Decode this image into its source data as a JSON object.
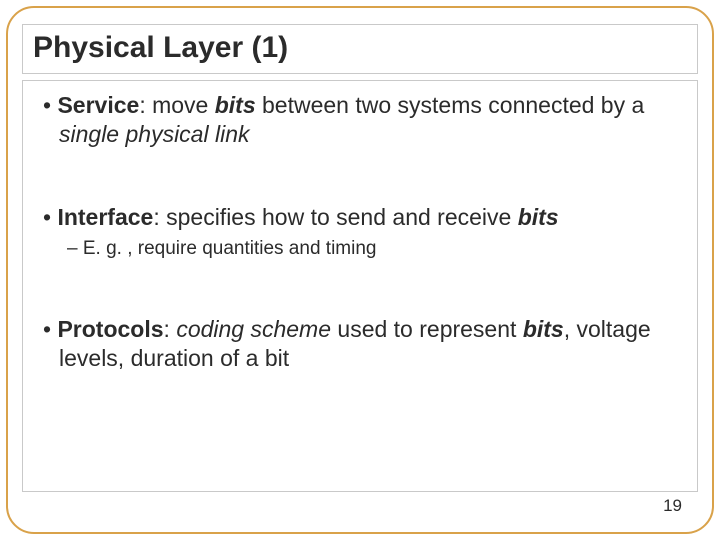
{
  "title": "Physical Layer (1)",
  "bullets": {
    "service_label": "Service",
    "service_rest1": ": move ",
    "service_bits": "bits",
    "service_rest2": " between two systems connected by a ",
    "service_link": "single physical link",
    "interface_label": "Interface",
    "interface_rest1": ": specifies how to send and receive ",
    "interface_bits": "bits",
    "interface_sub": "E. g. , require quantities and timing",
    "protocols_label": "Protocols",
    "protocols_rest1": ": ",
    "protocols_scheme": "coding scheme",
    "protocols_rest2": " used to represent ",
    "protocols_bits": "bits",
    "protocols_rest3": ", voltage levels, duration of a bit"
  },
  "page_number": "19"
}
